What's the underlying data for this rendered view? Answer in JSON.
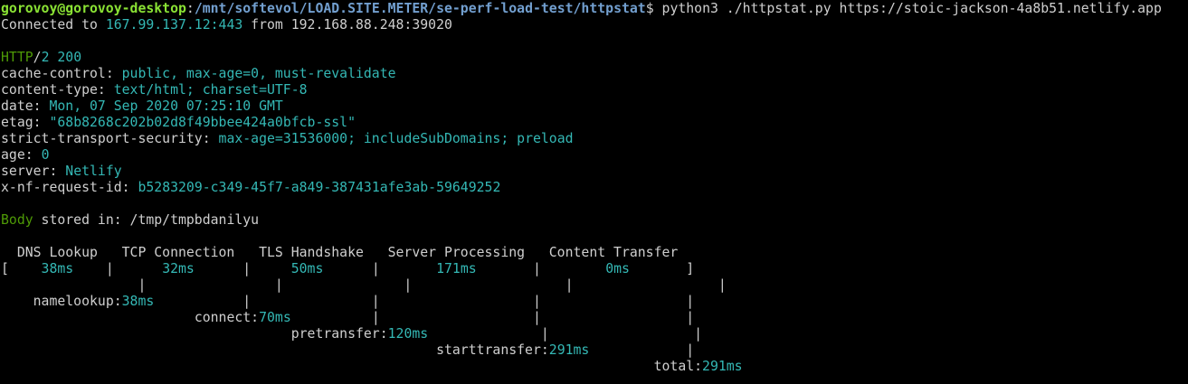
{
  "colors": {
    "background": "#000000",
    "text": "#cfcfcf",
    "prompt_user": "#8ae234",
    "prompt_path": "#729fcf",
    "value": "#34b8b5",
    "keyword": "#4e9a06"
  },
  "prompt": {
    "user_host": "gorovoy@gorovoy-desktop",
    "sep": ":",
    "path": "/mnt/softevol/LOAD.SITE.METER/se-perf-load-test/httpstat",
    "symbol": "$ ",
    "command": "python3 ./httpstat.py https://stoic-jackson-4a8b51.netlify.app"
  },
  "connection": {
    "prefix": "Connected to ",
    "remote": "167.99.137.12:443",
    "suffix": " from 192.168.88.248:39020"
  },
  "response": {
    "protocol": "HTTP",
    "slash": "/",
    "status": "2 200",
    "headers": [
      {
        "key": "cache-control",
        "value": "public, max-age=0, must-revalidate"
      },
      {
        "key": "content-type",
        "value": "text/html; charset=UTF-8"
      },
      {
        "key": "date",
        "value": "Mon, 07 Sep 2020 07:25:10 GMT"
      },
      {
        "key": "etag",
        "value": "\"68b8268c202b02d8f49bbee424a0bfcb-ssl\""
      },
      {
        "key": "strict-transport-security",
        "value": "max-age=31536000; includeSubDomains; preload"
      },
      {
        "key": "age",
        "value": "0"
      },
      {
        "key": "server",
        "value": "Netlify"
      },
      {
        "key": "x-nf-request-id",
        "value": "b5283209-c349-45f7-a849-387431afe3ab-59649252"
      }
    ]
  },
  "body": {
    "label": "Body",
    "text": " stored in: /tmp/tmpbdanilyu"
  },
  "timing": {
    "header_line": "  DNS Lookup   TCP Connection   TLS Handshake   Server Processing   Content Transfer",
    "phases": [
      {
        "name": "DNS Lookup",
        "duration": "38ms"
      },
      {
        "name": "TCP Connection",
        "duration": "32ms"
      },
      {
        "name": "TLS Handshake",
        "duration": "50ms"
      },
      {
        "name": "Server Processing",
        "duration": "171ms"
      },
      {
        "name": "Content Transfer",
        "duration": "0ms"
      }
    ],
    "cumulative": [
      {
        "label": "namelookup:",
        "value": "38ms"
      },
      {
        "label": "connect:",
        "value": "70ms"
      },
      {
        "label": "pretransfer:",
        "value": "120ms"
      },
      {
        "label": "starttransfer:",
        "value": "291ms"
      },
      {
        "label": "total:",
        "value": "291ms"
      }
    ]
  }
}
